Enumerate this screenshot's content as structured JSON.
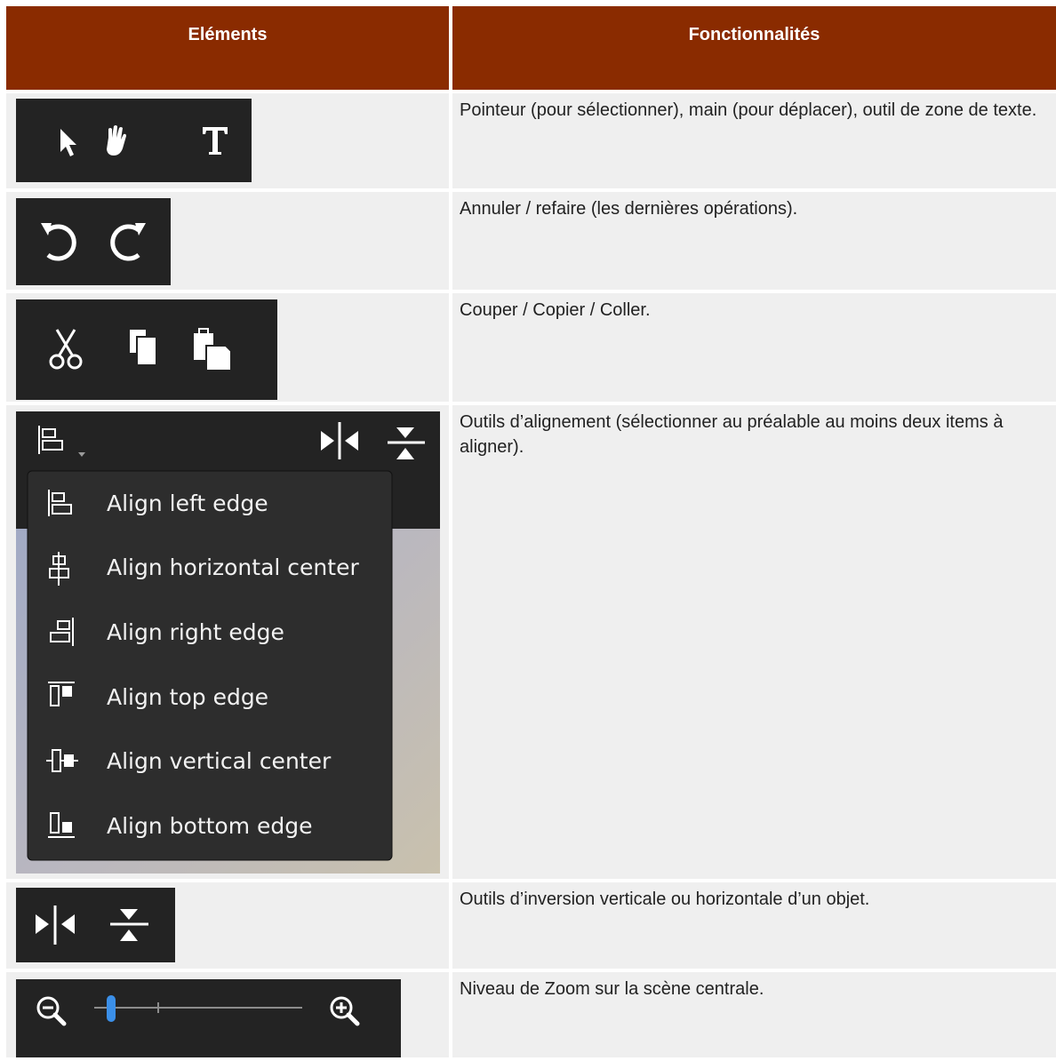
{
  "header": {
    "col_elements": "Eléments",
    "col_features": "Fonctionnalités"
  },
  "rows": [
    {
      "tools": [
        "pointer-icon",
        "hand-icon",
        "text-tool-icon"
      ],
      "description": "Pointeur (pour sélectionner), main (pour déplacer), outil de zone de texte."
    },
    {
      "tools": [
        "undo-icon",
        "redo-icon"
      ],
      "description": "Annuler / refaire (les dernières opérations)."
    },
    {
      "tools": [
        "cut-icon",
        "copy-icon",
        "paste-icon"
      ],
      "description": "Couper / Copier / Coller."
    },
    {
      "tools": [
        "align-left-edge-icon",
        "flip-horizontal-icon",
        "flip-vertical-icon"
      ],
      "menu": [
        {
          "label": "Align left edge",
          "icon": "align-left-edge-icon"
        },
        {
          "label": "Align horizontal center",
          "icon": "align-horizontal-center-icon"
        },
        {
          "label": "Align right edge",
          "icon": "align-right-edge-icon"
        },
        {
          "label": "Align top edge",
          "icon": "align-top-edge-icon"
        },
        {
          "label": "Align vertical center",
          "icon": "align-vertical-center-icon"
        },
        {
          "label": "Align bottom edge",
          "icon": "align-bottom-edge-icon"
        }
      ],
      "description": "Outils d’alignement (sélectionner au préalable au moins deux items à aligner)."
    },
    {
      "tools": [
        "flip-horizontal-icon",
        "flip-vertical-icon"
      ],
      "description": "Outils d’inversion verticale ou horizontale d’un objet."
    },
    {
      "tools": [
        "zoom-out-icon",
        "zoom-slider",
        "zoom-in-icon"
      ],
      "description": "Niveau de Zoom sur la scène centrale."
    }
  ],
  "colors": {
    "header_bg": "#8a2b00",
    "row_bg": "#efefef",
    "toolbar_bg": "#232323",
    "slider_accent": "#3b8fe8"
  }
}
